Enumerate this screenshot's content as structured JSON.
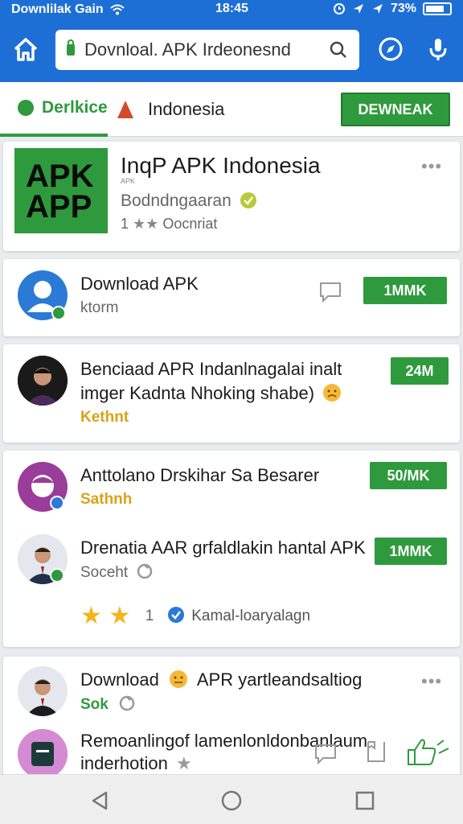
{
  "status_bar": {
    "left_text": "Downlilak Gain",
    "time": "18:45",
    "battery": "73%",
    "icons": [
      "wifi-icon",
      "alarm-icon",
      "location-icon",
      "signal-icon",
      "battery-icon"
    ]
  },
  "toolbar": {
    "url": "Dovnloal. APK Irdeonesnd",
    "icons": [
      "home-icon",
      "lock-icon",
      "search-icon",
      "compass-icon",
      "mic-icon"
    ]
  },
  "tabs": {
    "tab_1": "Derlkice",
    "tab_2": "Indonesia",
    "download_button": "DEWNEAK"
  },
  "hero": {
    "icon_line1": "APK",
    "icon_line2": "APP",
    "title": "InqP APK Indonesia",
    "meta": "APK",
    "subtitle": "Bodndngaaran",
    "rating_count": "1",
    "rating_text": "Oocnriat",
    "more": "•••"
  },
  "items": [
    {
      "title": "Download APK",
      "subtitle": "ktorm",
      "badge": "1MMK"
    },
    {
      "title": "Benciaad APR Indanlnagalai inalt",
      "title_line2": "imger Kadnta Nhoking shabe)",
      "subtitle": "Kethnt",
      "badge": "24M"
    },
    {
      "title": "Anttolano Drskihar Sa Besarer",
      "subtitle": "Sathnh",
      "badge": "50/MK"
    },
    {
      "title": "Drenatia AAR grfaldlakin hantal APK",
      "subtitle": "Soceht",
      "badge": "1MMK",
      "rating_count": "1",
      "rating_text": "Kamal-loaryalagn"
    },
    {
      "title": "Download",
      "title_after_emoji": "APR yartleandsaltiog",
      "subtitle": "Sok",
      "more": "•••"
    },
    {
      "title": "Remoanlingof lamenlonldonbanlaum",
      "title_line2": "inderhotion"
    }
  ],
  "colors": {
    "accent": "#1d6fd6",
    "green": "#2e9a3d",
    "star": "#f2b51b",
    "emoji": "#f5b93a"
  }
}
